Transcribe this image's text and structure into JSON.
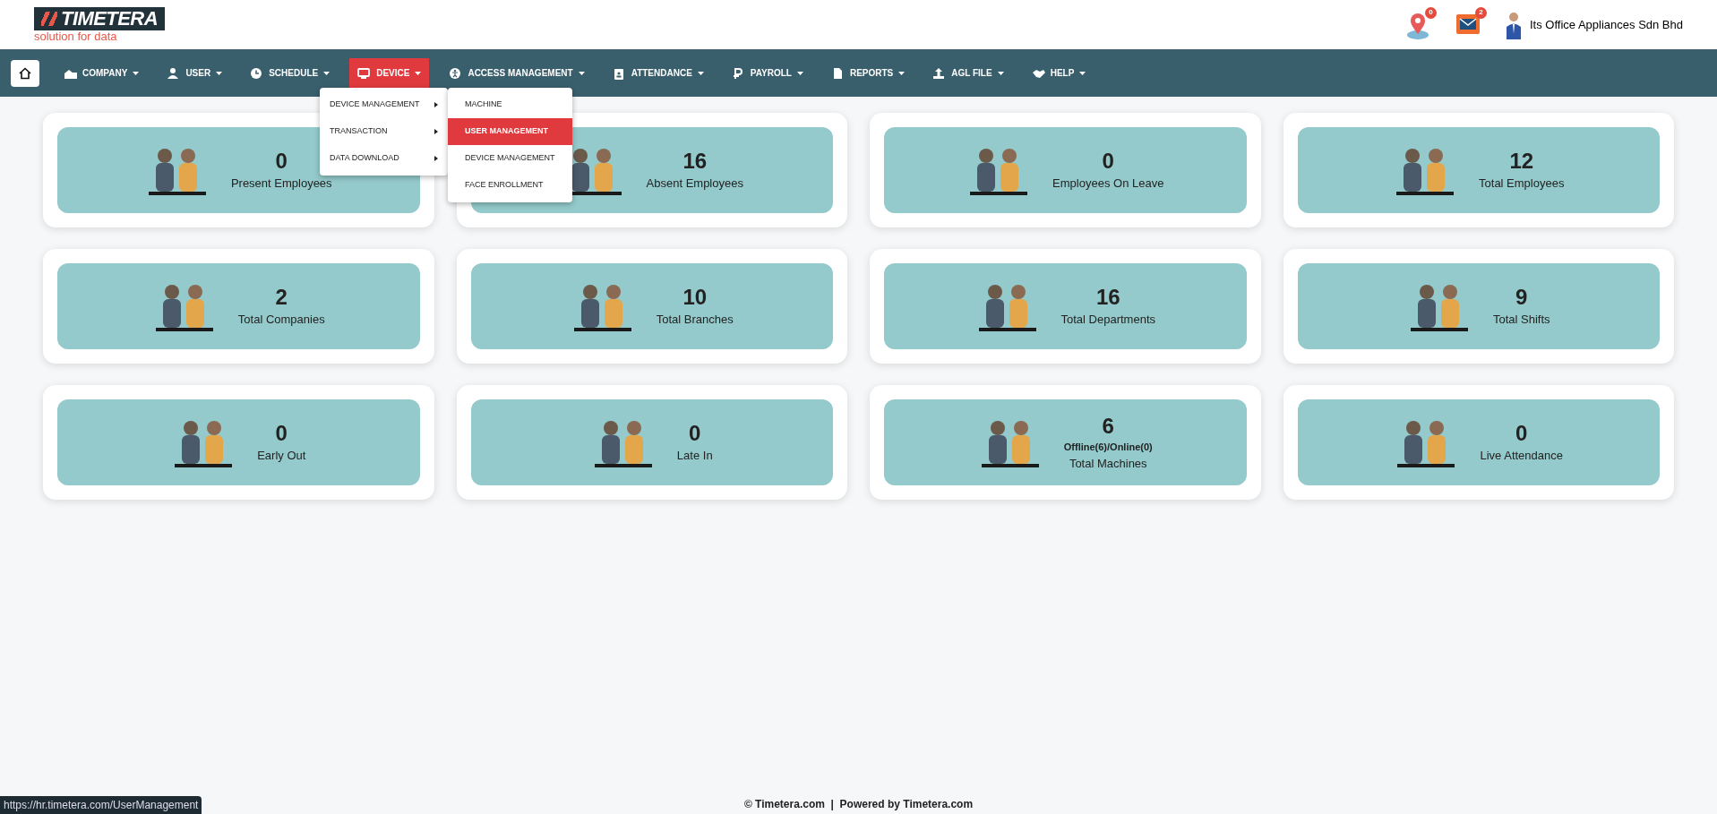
{
  "header": {
    "logo": {
      "name": "TIMETERA",
      "tagline": "solution for data"
    },
    "notifications": [
      {
        "kind": "location",
        "count": "0"
      },
      {
        "kind": "mail",
        "count": "2"
      }
    ],
    "company": "Its Office Appliances Sdn Bhd"
  },
  "nav": {
    "items": [
      {
        "label": "COMPANY",
        "selected": false
      },
      {
        "label": "USER",
        "selected": false
      },
      {
        "label": "SCHEDULE",
        "selected": false
      },
      {
        "label": "DEVICE",
        "selected": true
      },
      {
        "label": "ACCESS MANAGEMENT",
        "selected": false
      },
      {
        "label": "ATTENDANCE",
        "selected": false
      },
      {
        "label": "PAYROLL",
        "selected": false
      },
      {
        "label": "REPORTS",
        "selected": false
      },
      {
        "label": "AGL FILE",
        "selected": false
      },
      {
        "label": "HELP",
        "selected": false
      }
    ]
  },
  "dropdown": {
    "items": [
      {
        "label": "DEVICE MANAGEMENT",
        "submenu": true
      },
      {
        "label": "TRANSACTION",
        "submenu": true
      },
      {
        "label": "DATA DOWNLOAD",
        "submenu": true
      }
    ]
  },
  "submenu": {
    "items": [
      {
        "label": "MACHINE",
        "selected": false
      },
      {
        "label": "USER MANAGEMENT",
        "selected": true
      },
      {
        "label": "DEVICE MANAGEMENT",
        "selected": false
      },
      {
        "label": "FACE ENROLLMENT",
        "selected": false
      }
    ]
  },
  "cards": [
    {
      "value": "0",
      "label": "Present Employees"
    },
    {
      "value": "16",
      "label": "Absent Employees"
    },
    {
      "value": "0",
      "label": "Employees On Leave"
    },
    {
      "value": "12",
      "label": "Total Employees"
    },
    {
      "value": "2",
      "label": "Total Companies"
    },
    {
      "value": "10",
      "label": "Total Branches"
    },
    {
      "value": "16",
      "label": "Total Departments"
    },
    {
      "value": "9",
      "label": "Total Shifts"
    },
    {
      "value": "0",
      "label": "Early Out"
    },
    {
      "value": "0",
      "label": "Late In"
    },
    {
      "value": "6",
      "detail": "Offline(6)/Online(0)",
      "label": "Total Machines"
    },
    {
      "value": "0",
      "label": "Live Attendance"
    }
  ],
  "footer": "© Timetera.com  |  Powered by Timetera.com",
  "status_url": "https://hr.timetera.com/UserManagement"
}
